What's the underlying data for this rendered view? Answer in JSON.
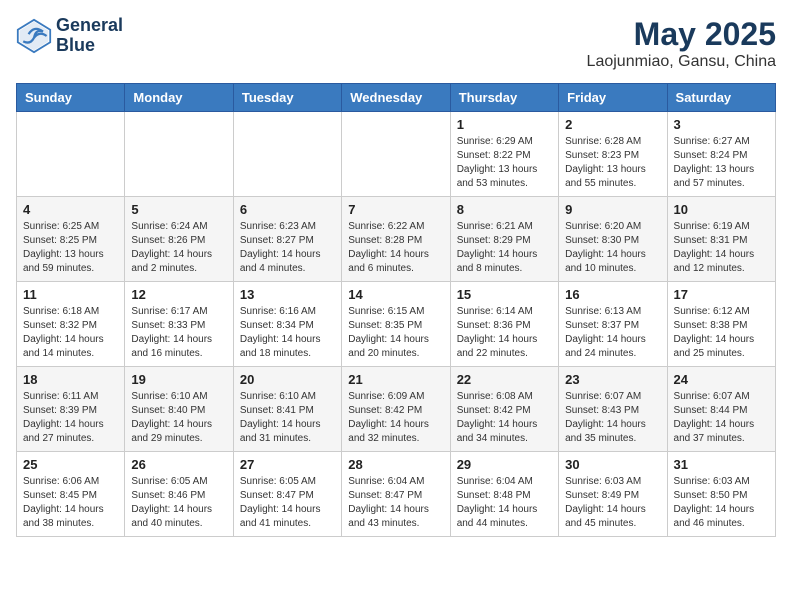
{
  "header": {
    "logo_line1": "General",
    "logo_line2": "Blue",
    "title": "May 2025",
    "subtitle": "Laojunmiao, Gansu, China"
  },
  "calendar": {
    "days_of_week": [
      "Sunday",
      "Monday",
      "Tuesday",
      "Wednesday",
      "Thursday",
      "Friday",
      "Saturday"
    ],
    "weeks": [
      [
        {
          "num": "",
          "info": ""
        },
        {
          "num": "",
          "info": ""
        },
        {
          "num": "",
          "info": ""
        },
        {
          "num": "",
          "info": ""
        },
        {
          "num": "1",
          "info": "Sunrise: 6:29 AM\nSunset: 8:22 PM\nDaylight: 13 hours\nand 53 minutes."
        },
        {
          "num": "2",
          "info": "Sunrise: 6:28 AM\nSunset: 8:23 PM\nDaylight: 13 hours\nand 55 minutes."
        },
        {
          "num": "3",
          "info": "Sunrise: 6:27 AM\nSunset: 8:24 PM\nDaylight: 13 hours\nand 57 minutes."
        }
      ],
      [
        {
          "num": "4",
          "info": "Sunrise: 6:25 AM\nSunset: 8:25 PM\nDaylight: 13 hours\nand 59 minutes."
        },
        {
          "num": "5",
          "info": "Sunrise: 6:24 AM\nSunset: 8:26 PM\nDaylight: 14 hours\nand 2 minutes."
        },
        {
          "num": "6",
          "info": "Sunrise: 6:23 AM\nSunset: 8:27 PM\nDaylight: 14 hours\nand 4 minutes."
        },
        {
          "num": "7",
          "info": "Sunrise: 6:22 AM\nSunset: 8:28 PM\nDaylight: 14 hours\nand 6 minutes."
        },
        {
          "num": "8",
          "info": "Sunrise: 6:21 AM\nSunset: 8:29 PM\nDaylight: 14 hours\nand 8 minutes."
        },
        {
          "num": "9",
          "info": "Sunrise: 6:20 AM\nSunset: 8:30 PM\nDaylight: 14 hours\nand 10 minutes."
        },
        {
          "num": "10",
          "info": "Sunrise: 6:19 AM\nSunset: 8:31 PM\nDaylight: 14 hours\nand 12 minutes."
        }
      ],
      [
        {
          "num": "11",
          "info": "Sunrise: 6:18 AM\nSunset: 8:32 PM\nDaylight: 14 hours\nand 14 minutes."
        },
        {
          "num": "12",
          "info": "Sunrise: 6:17 AM\nSunset: 8:33 PM\nDaylight: 14 hours\nand 16 minutes."
        },
        {
          "num": "13",
          "info": "Sunrise: 6:16 AM\nSunset: 8:34 PM\nDaylight: 14 hours\nand 18 minutes."
        },
        {
          "num": "14",
          "info": "Sunrise: 6:15 AM\nSunset: 8:35 PM\nDaylight: 14 hours\nand 20 minutes."
        },
        {
          "num": "15",
          "info": "Sunrise: 6:14 AM\nSunset: 8:36 PM\nDaylight: 14 hours\nand 22 minutes."
        },
        {
          "num": "16",
          "info": "Sunrise: 6:13 AM\nSunset: 8:37 PM\nDaylight: 14 hours\nand 24 minutes."
        },
        {
          "num": "17",
          "info": "Sunrise: 6:12 AM\nSunset: 8:38 PM\nDaylight: 14 hours\nand 25 minutes."
        }
      ],
      [
        {
          "num": "18",
          "info": "Sunrise: 6:11 AM\nSunset: 8:39 PM\nDaylight: 14 hours\nand 27 minutes."
        },
        {
          "num": "19",
          "info": "Sunrise: 6:10 AM\nSunset: 8:40 PM\nDaylight: 14 hours\nand 29 minutes."
        },
        {
          "num": "20",
          "info": "Sunrise: 6:10 AM\nSunset: 8:41 PM\nDaylight: 14 hours\nand 31 minutes."
        },
        {
          "num": "21",
          "info": "Sunrise: 6:09 AM\nSunset: 8:42 PM\nDaylight: 14 hours\nand 32 minutes."
        },
        {
          "num": "22",
          "info": "Sunrise: 6:08 AM\nSunset: 8:42 PM\nDaylight: 14 hours\nand 34 minutes."
        },
        {
          "num": "23",
          "info": "Sunrise: 6:07 AM\nSunset: 8:43 PM\nDaylight: 14 hours\nand 35 minutes."
        },
        {
          "num": "24",
          "info": "Sunrise: 6:07 AM\nSunset: 8:44 PM\nDaylight: 14 hours\nand 37 minutes."
        }
      ],
      [
        {
          "num": "25",
          "info": "Sunrise: 6:06 AM\nSunset: 8:45 PM\nDaylight: 14 hours\nand 38 minutes."
        },
        {
          "num": "26",
          "info": "Sunrise: 6:05 AM\nSunset: 8:46 PM\nDaylight: 14 hours\nand 40 minutes."
        },
        {
          "num": "27",
          "info": "Sunrise: 6:05 AM\nSunset: 8:47 PM\nDaylight: 14 hours\nand 41 minutes."
        },
        {
          "num": "28",
          "info": "Sunrise: 6:04 AM\nSunset: 8:47 PM\nDaylight: 14 hours\nand 43 minutes."
        },
        {
          "num": "29",
          "info": "Sunrise: 6:04 AM\nSunset: 8:48 PM\nDaylight: 14 hours\nand 44 minutes."
        },
        {
          "num": "30",
          "info": "Sunrise: 6:03 AM\nSunset: 8:49 PM\nDaylight: 14 hours\nand 45 minutes."
        },
        {
          "num": "31",
          "info": "Sunrise: 6:03 AM\nSunset: 8:50 PM\nDaylight: 14 hours\nand 46 minutes."
        }
      ]
    ]
  }
}
